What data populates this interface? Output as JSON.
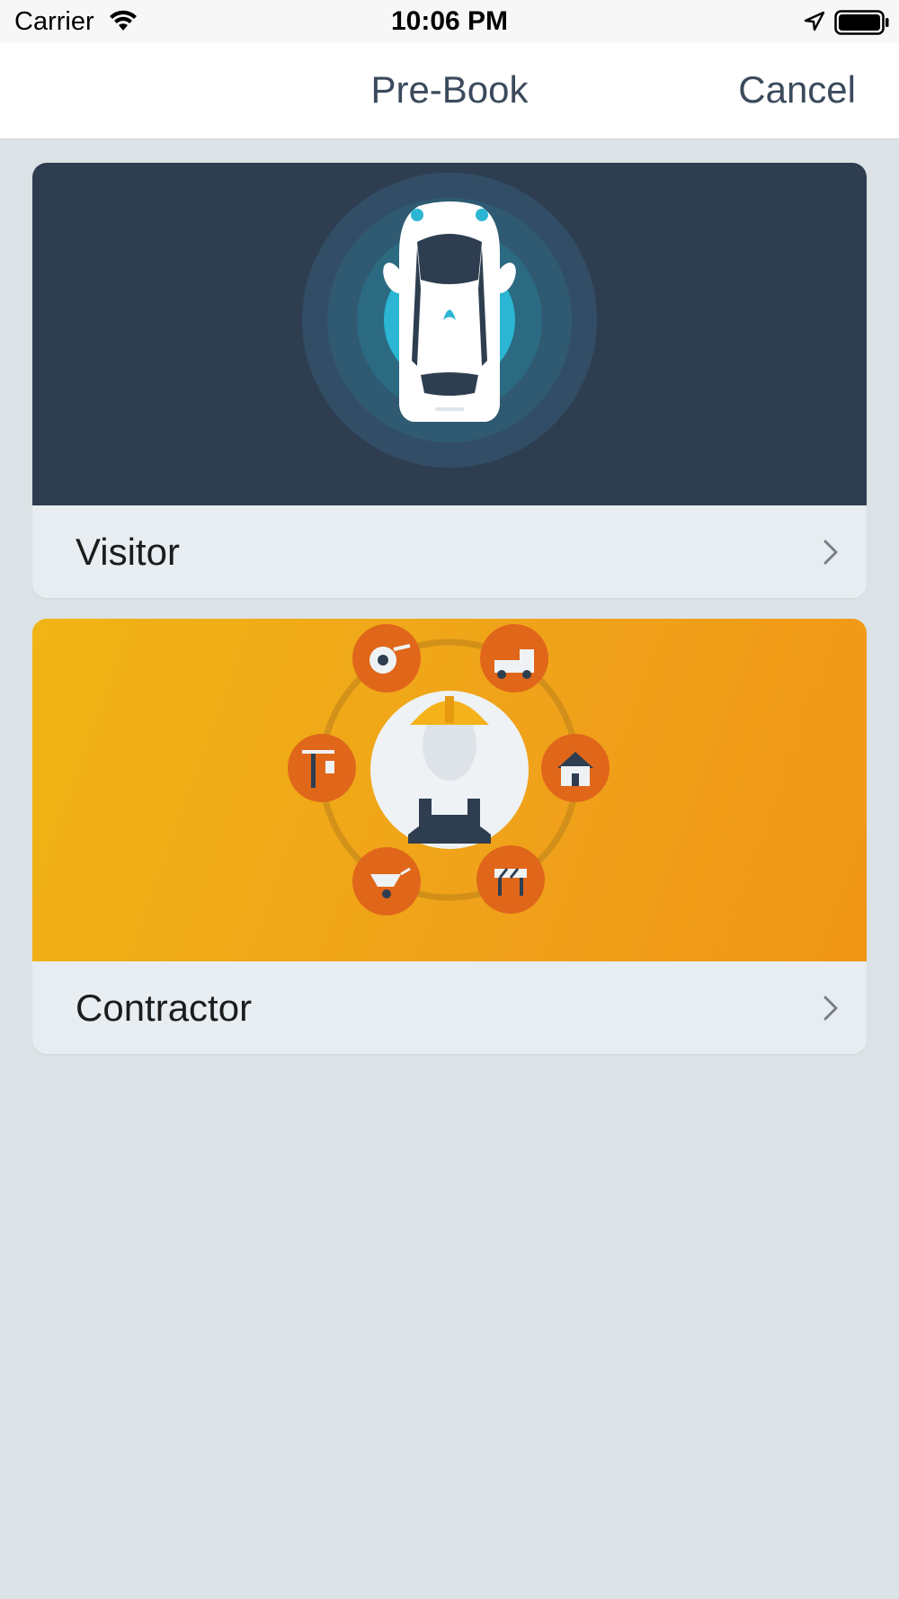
{
  "status_bar": {
    "carrier": "Carrier",
    "time": "10:06 PM",
    "icons": [
      "wifi-icon",
      "location-arrow-icon",
      "battery-icon"
    ]
  },
  "nav": {
    "title": "Pre-Book",
    "cancel_label": "Cancel"
  },
  "cards": [
    {
      "label": "Visitor",
      "illustration": "car-radar-illustration",
      "banner_color": "#2e3e50"
    },
    {
      "label": "Contractor",
      "illustration": "contractor-worker-illustration",
      "banner_color": "#f0a81a"
    }
  ],
  "colors": {
    "background": "#dce3e7",
    "nav_text": "#3b4a5c",
    "card_footer": "#e8edf1",
    "visitor_accent": "#2bb6d3",
    "contractor_orange": "#e0661a"
  }
}
